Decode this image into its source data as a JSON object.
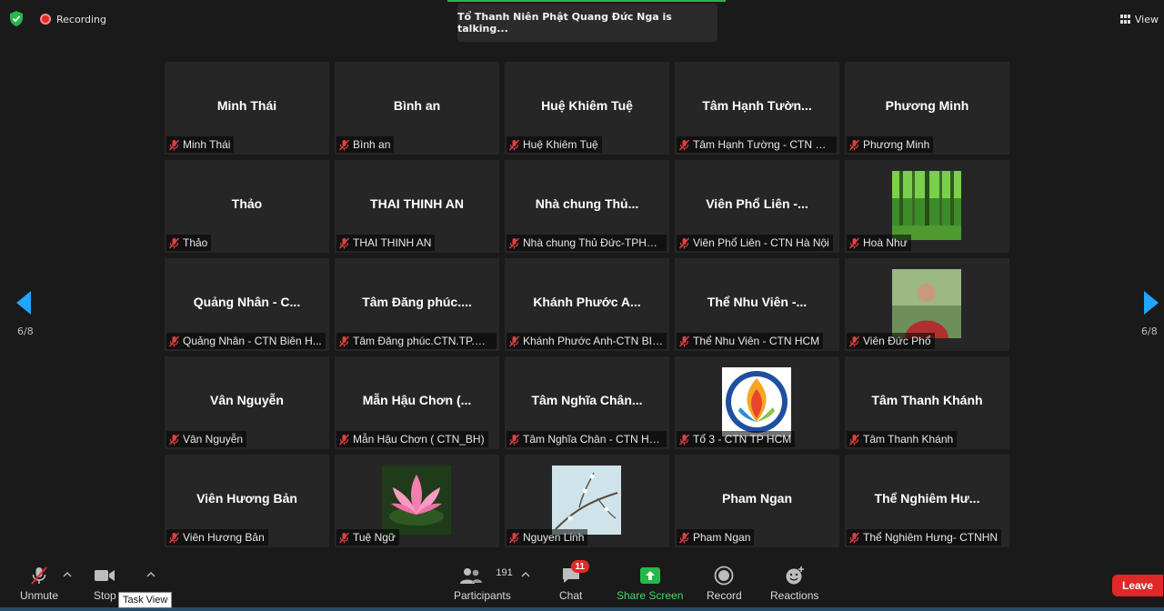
{
  "topbar": {
    "recording_label": "Recording",
    "talking_text": "Tổ Thanh Niên Phật Quang Đức Nga is talking...",
    "view_label": "View"
  },
  "pagination": {
    "left": "6/8",
    "right": "6/8"
  },
  "tiles": [
    {
      "name": "Minh Thái",
      "label": "Minh Thái"
    },
    {
      "name": "Bình an",
      "label": "Bình an"
    },
    {
      "name": "Huệ Khiêm Tuệ",
      "label": "Huệ Khiêm Tuệ"
    },
    {
      "name": "Tâm Hạnh Tườn...",
      "label": "Tâm Hạnh Tường - CTN Bì..."
    },
    {
      "name": "Phương Minh",
      "label": "Phương Minh"
    },
    {
      "name": "Thảo",
      "label": "Thảo"
    },
    {
      "name": "THAI THINH AN",
      "label": "THAI THINH AN"
    },
    {
      "name": "Nhà chung Thủ...",
      "label": "Nhà chung Thủ Đức-TPHCM"
    },
    {
      "name": "Viên Phổ Liên -...",
      "label": "Viên Phổ Liên - CTN Hà Nội"
    },
    {
      "name": "",
      "label": "Hoà Như",
      "avatar": "forest"
    },
    {
      "name": "Quảng Nhân - C...",
      "label": "Quảng Nhân - CTN Biên H..."
    },
    {
      "name": "Tâm Đăng phúc....",
      "label": "Tâm Đăng phúc.CTN.TP.HC..."
    },
    {
      "name": "Khánh Phước A...",
      "label": "Khánh Phước Anh-CTN BIÊ..."
    },
    {
      "name": "Thể Nhu Viên -...",
      "label": "Thể Nhu Viên - CTN HCM"
    },
    {
      "name": "",
      "label": "Viên Đức Phổ",
      "avatar": "person"
    },
    {
      "name": "Vân Nguyễn",
      "label": "Vân Nguyễn"
    },
    {
      "name": "Mẫn Hậu Chơn (...",
      "label": "Mẫn Hậu Chơn ( CTN_BH)"
    },
    {
      "name": "Tâm Nghĩa Chân...",
      "label": "Tâm Nghĩa Chân - CTN Hà ..."
    },
    {
      "name": "",
      "label": "Tổ 3 - CTN TP HCM",
      "avatar": "logo"
    },
    {
      "name": "Tâm Thanh Khánh",
      "label": "Tâm Thanh Khánh"
    },
    {
      "name": "Viên Hương Bản",
      "label": "Viên Hương Bản"
    },
    {
      "name": "",
      "label": "Tuệ Ngữ",
      "avatar": "lotus"
    },
    {
      "name": "",
      "label": "Nguyen Linh",
      "avatar": "branch"
    },
    {
      "name": "Pham Ngan",
      "label": "Pham Ngan"
    },
    {
      "name": "Thể Nghiêm Hư...",
      "label": "Thể Nghiêm Hưng- CTNHN"
    }
  ],
  "toolbar": {
    "unmute": "Unmute",
    "stop_video": "Stop",
    "participants": "Participants",
    "participants_count": "191",
    "chat": "Chat",
    "chat_badge": "11",
    "share_screen": "Share Screen",
    "record": "Record",
    "reactions": "Reactions",
    "leave": "Leave",
    "tooltip": "Task View"
  },
  "colors": {
    "share_green": "#3ddc65",
    "leave_red": "#e02828",
    "badge_red": "#e02b2b",
    "arrow_blue": "#1ea7fd"
  }
}
